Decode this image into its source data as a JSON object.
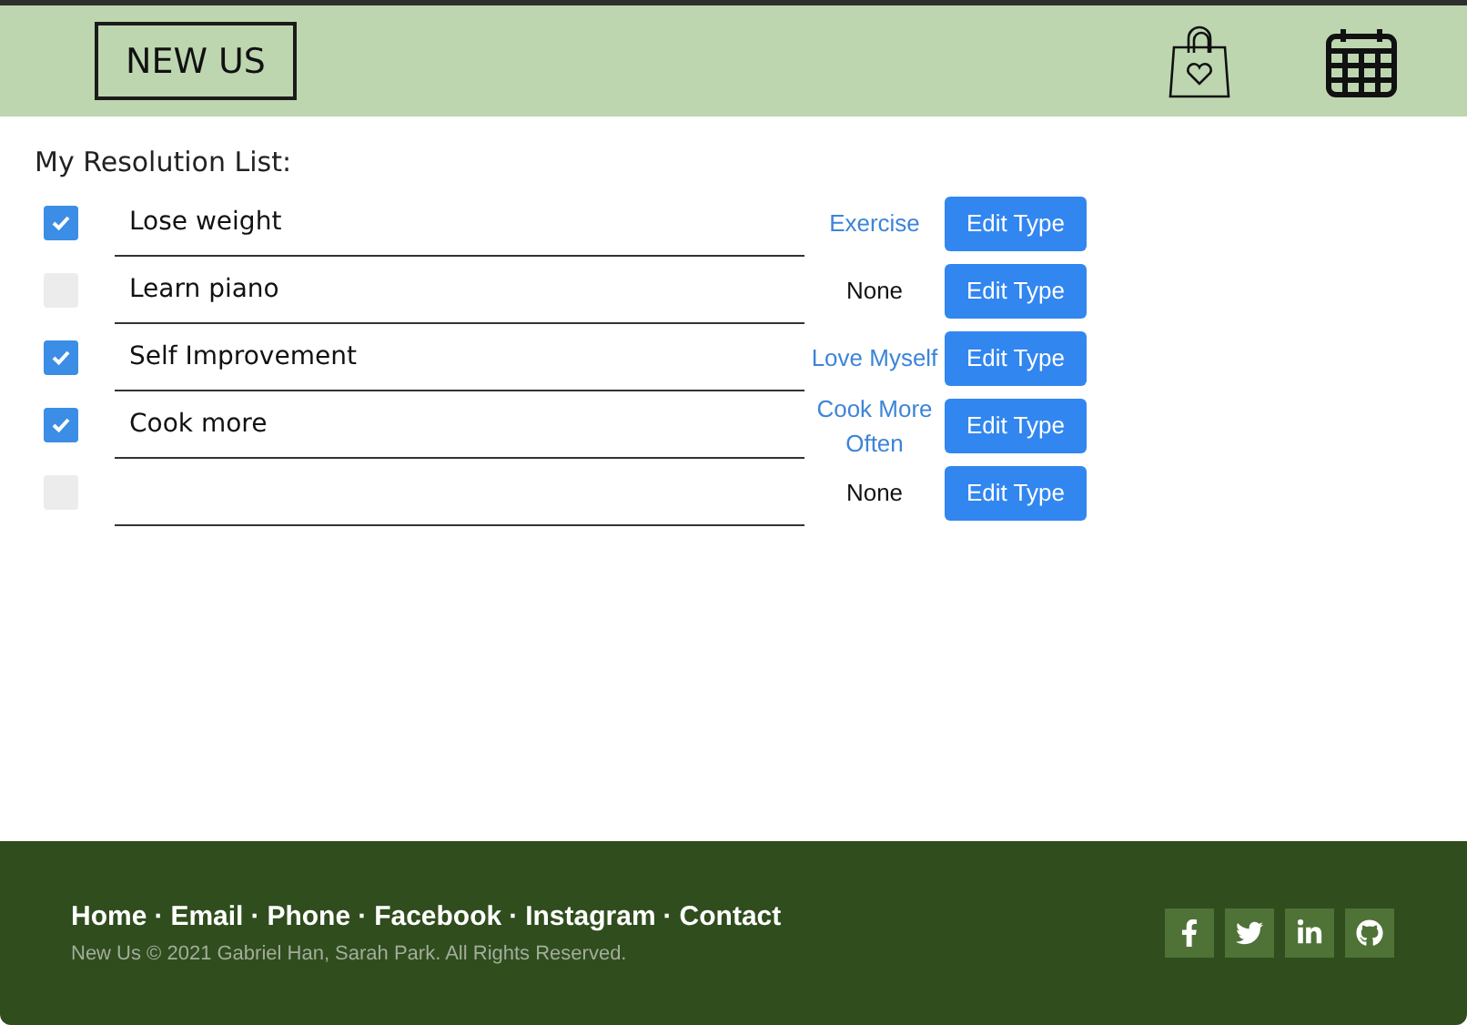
{
  "header": {
    "logo": "NEW US"
  },
  "list": {
    "title": "My Resolution List:",
    "rows": [
      {
        "checked": true,
        "text": "Lose weight",
        "type": "Exercise",
        "assigned": true,
        "button": "Edit Type"
      },
      {
        "checked": false,
        "text": "Learn piano",
        "type": "None",
        "assigned": false,
        "button": "Edit Type"
      },
      {
        "checked": true,
        "text": "Self Improvement",
        "type": "Love Myself",
        "assigned": true,
        "button": "Edit Type"
      },
      {
        "checked": true,
        "text": "Cook more",
        "type": "Cook More Often",
        "assigned": true,
        "button": "Edit Type"
      },
      {
        "checked": false,
        "type": "None",
        "assigned": false,
        "button": "Edit Type"
      }
    ]
  },
  "footer": {
    "links": [
      "Home",
      "Email",
      "Phone",
      "Facebook",
      "Instagram",
      "Contact"
    ],
    "separator": "·",
    "copyright": "New Us © 2021 Gabriel Han, Sarah Park. All Rights Reserved.",
    "social": [
      {
        "kind": "facebook"
      },
      {
        "kind": "twitter"
      },
      {
        "kind": "linkedin"
      },
      {
        "kind": "github"
      }
    ]
  }
}
